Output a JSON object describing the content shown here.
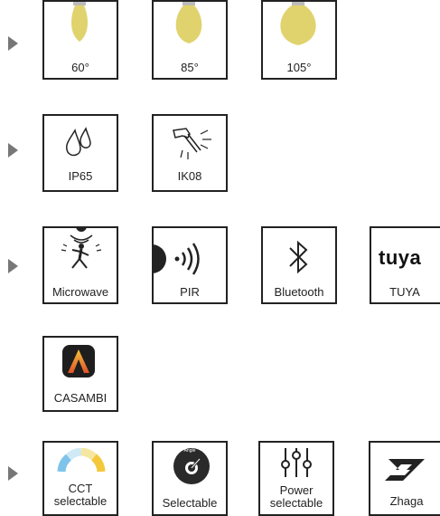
{
  "beam_angles": [
    {
      "label": "60°"
    },
    {
      "label": "85°"
    },
    {
      "label": "105°"
    }
  ],
  "protection": [
    {
      "label": "IP65",
      "icon": "water-drops-icon"
    },
    {
      "label": "IK08",
      "icon": "hammer-impact-icon"
    }
  ],
  "sensors": [
    {
      "label": "Microwave",
      "icon": "microwave-sensor-icon"
    },
    {
      "label": "PIR",
      "icon": "pir-sensor-icon"
    },
    {
      "label": "Bluetooth",
      "icon": "bluetooth-icon"
    },
    {
      "label": "TUYA",
      "logo_text": "tuya",
      "icon": "tuya-logo"
    }
  ],
  "casambi": {
    "label": "CASAMBI",
    "icon": "casambi-logo"
  },
  "features": [
    {
      "label_line1": "CCT",
      "label_line2": "selectable",
      "icon": "cct-arc-icon"
    },
    {
      "label": "Selectable",
      "gauge_text": "Angle",
      "icon": "angle-gauge-icon"
    },
    {
      "label_line1": "Power",
      "label_line2": "selectable",
      "icon": "sliders-icon"
    },
    {
      "label": "Zhaga",
      "icon": "zhaga-logo"
    }
  ],
  "colors": {
    "bulb": "#e0d36e",
    "arrow": "#777777",
    "border": "#222222"
  }
}
